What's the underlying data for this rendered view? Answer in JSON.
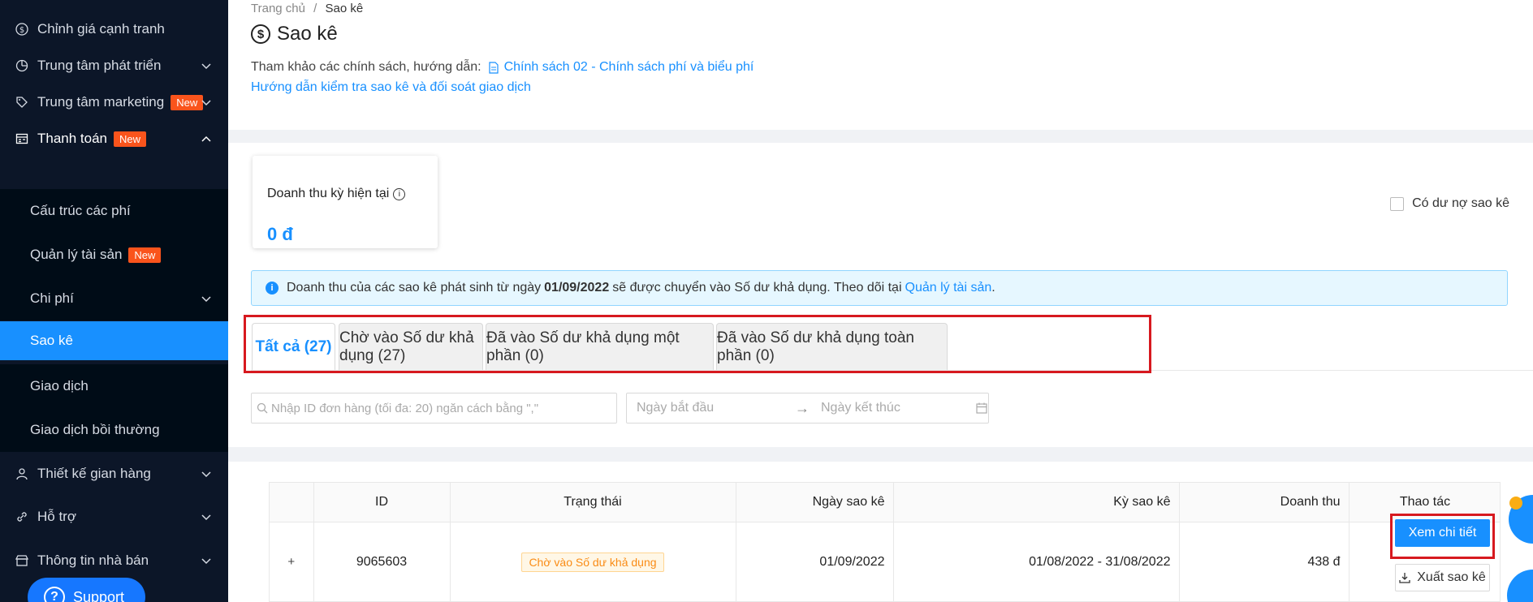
{
  "sidebar": {
    "items": [
      {
        "label": "Chỉnh giá cạnh tranh",
        "icon": "dollar-circle-icon"
      },
      {
        "label": "Trung tâm phát triển",
        "icon": "pie-chart-icon"
      },
      {
        "label": "Trung tâm marketing",
        "icon": "tag-icon",
        "badge": "New"
      },
      {
        "label": "Thanh toán",
        "icon": "wallet-icon",
        "badge": "New"
      },
      {
        "label": "Cấu trúc các phí"
      },
      {
        "label": "Quản lý tài sản",
        "badge": "New"
      },
      {
        "label": "Chi phí"
      },
      {
        "label": "Sao kê"
      },
      {
        "label": "Giao dịch"
      },
      {
        "label": "Giao dịch bồi thường"
      },
      {
        "label": "Thiết kế gian hàng",
        "icon": "user-icon"
      },
      {
        "label": "Hỗ trợ",
        "icon": "link-icon"
      },
      {
        "label": "Thông tin nhà bán",
        "icon": "store-icon"
      }
    ],
    "support_label": "Support"
  },
  "breadcrumb": {
    "home": "Trang chủ",
    "separator": "/",
    "current": "Sao kê"
  },
  "page_title": "Sao kê",
  "reference": {
    "prefix": "Tham khảo các chính sách, hướng dẫn:",
    "policy_link": "Chính sách 02 - Chính sách phí và biểu phí",
    "guide_link": "Hướng dẫn kiểm tra sao kê và đối soát giao dịch"
  },
  "revenue_card": {
    "label": "Doanh thu kỳ hiện tại",
    "value": "0 đ"
  },
  "debt_checkbox_label": "Có dư nợ sao kê",
  "alert": {
    "text_before": "Doanh thu của các sao kê phát sinh từ ngày",
    "date": "01/09/2022",
    "text_after": "sẽ được chuyển vào Số dư khả dụng. Theo dõi tại",
    "link": "Quản lý tài sản",
    "end": "."
  },
  "tabs": [
    {
      "label": "Tất cả (27)",
      "active": true
    },
    {
      "label": "Chờ vào Số dư khả dụng (27)",
      "active": false
    },
    {
      "label": "Đã vào Số dư khả dụng một phần (0)",
      "active": false
    },
    {
      "label": "Đã vào Số dư khả dụng toàn phần (0)",
      "active": false
    }
  ],
  "filters": {
    "search_placeholder": "Nhập ID đơn hàng (tối đa: 20) ngăn cách bằng \",\"",
    "start_date_placeholder": "Ngày bắt đầu",
    "end_date_placeholder": "Ngày kết thúc"
  },
  "table": {
    "headers": [
      "",
      "ID",
      "Trạng thái",
      "Ngày sao kê",
      "Kỳ sao kê",
      "Doanh thu",
      "Thao tác"
    ],
    "rows": [
      {
        "expand": "+",
        "id": "9065603",
        "status": "Chờ vào Số dư khả dụng",
        "statement_date": "01/09/2022",
        "period": "01/08/2022 - 31/08/2022",
        "revenue": "438 đ",
        "view_label": "Xem chi tiết",
        "export_label": "Xuất sao kê"
      }
    ]
  },
  "colors": {
    "sidebar_bg": "#0c1628",
    "accent": "#1890ff",
    "badge": "#fa541c",
    "highlight_frame": "#d7191f",
    "status_orange": "#fa8c16"
  }
}
